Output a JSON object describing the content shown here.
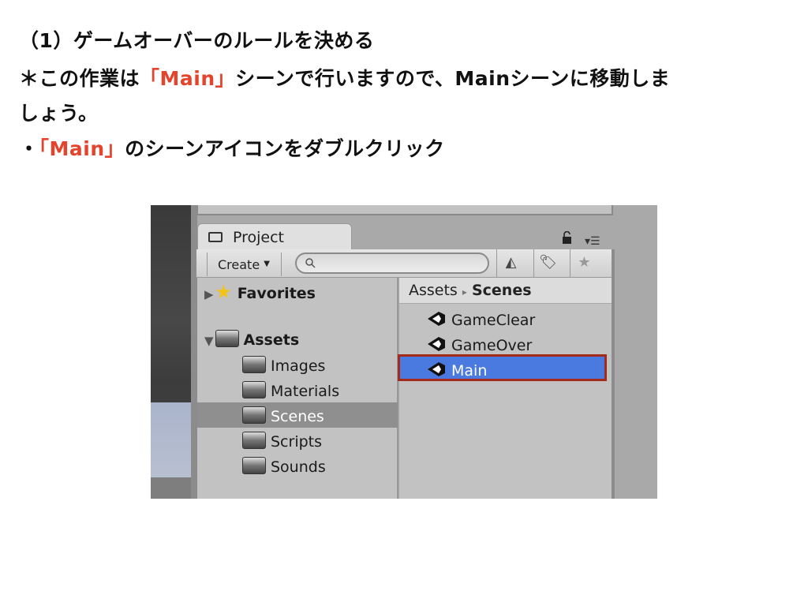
{
  "slide": {
    "line1": "（1）ゲームオーバーのルールを決める",
    "line2_pre": "＊この作業は",
    "line2_red": "「Main」",
    "line2_post": "シーンで行いますので、Mainシーンに移動しま",
    "line3": "しょう。",
    "line4_pre": "・",
    "line4_red": "「Main」",
    "line4_post": "のシーンアイコンをダブルクリック",
    "accent_color": "#e5432b"
  },
  "unity": {
    "tab_label": "Project",
    "create_label": "Create",
    "search_placeholder": "",
    "breadcrumb": {
      "root": "Assets",
      "separator": "▸",
      "current": "Scenes"
    },
    "tree": {
      "favorites": "Favorites",
      "assets": "Assets",
      "folders": [
        "Images",
        "Materials",
        "Scenes",
        "Scripts",
        "Sounds"
      ],
      "selected": "Scenes"
    },
    "scenes": [
      "GameClear",
      "GameOver",
      "Main"
    ],
    "selected_scene": "Main",
    "highlight_color": "#a42a1a",
    "selection_color": "#4a7ae0"
  }
}
